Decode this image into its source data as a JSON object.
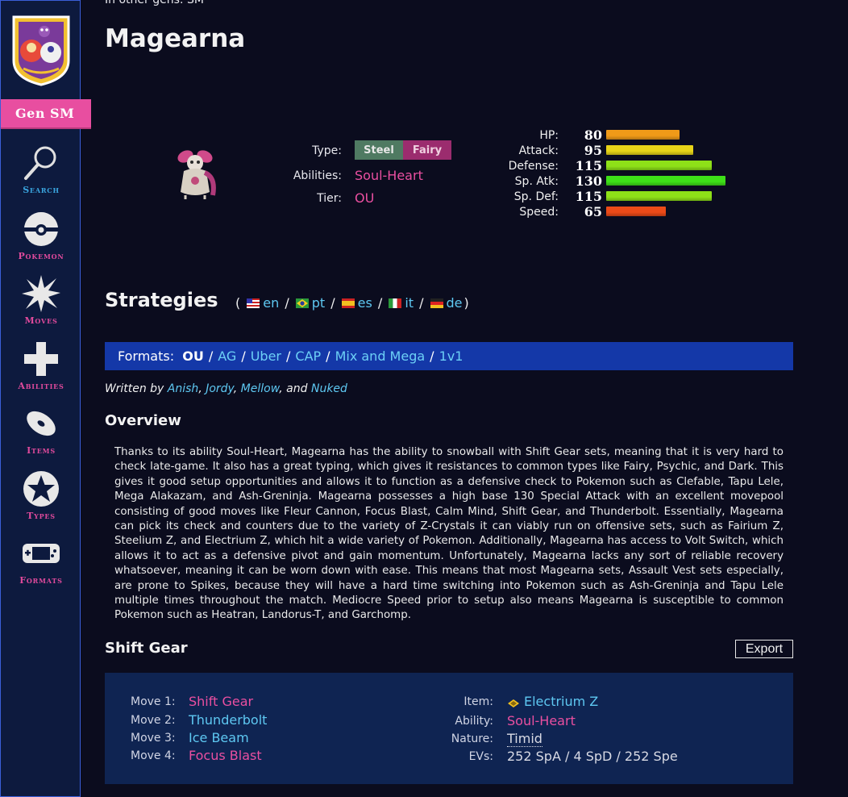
{
  "sidebar": {
    "gen_label": "Gen SM",
    "nav": [
      {
        "label": "Search",
        "icon": "search-icon"
      },
      {
        "label": "Pokemon",
        "icon": "pokeball-icon"
      },
      {
        "label": "Moves",
        "icon": "burst-icon"
      },
      {
        "label": "Abilities",
        "icon": "plus-icon"
      },
      {
        "label": "Items",
        "icon": "disc-icon"
      },
      {
        "label": "Types",
        "icon": "star-icon"
      },
      {
        "label": "Formats",
        "icon": "gameboy-icon"
      }
    ]
  },
  "header": {
    "other_gens": "In other gens: SM",
    "title": "Magearna"
  },
  "info": {
    "type_label": "Type:",
    "types": [
      "Steel",
      "Fairy"
    ],
    "abilities_label": "Abilities:",
    "ability": "Soul-Heart",
    "tier_label": "Tier:",
    "tier": "OU"
  },
  "stats": [
    {
      "name": "HP:",
      "value": 80,
      "color": "#f09a18"
    },
    {
      "name": "Attack:",
      "value": 95,
      "color": "#e8d418"
    },
    {
      "name": "Defense:",
      "value": 115,
      "color": "#8ee018"
    },
    {
      "name": "Sp. Atk:",
      "value": 130,
      "color": "#3ee018"
    },
    {
      "name": "Sp. Def:",
      "value": 115,
      "color": "#8ee018"
    },
    {
      "name": "Speed:",
      "value": 65,
      "color": "#ec4a18"
    }
  ],
  "strategies": {
    "heading": "Strategies",
    "open_paren": "(",
    "close_paren": ")",
    "languages": [
      "en",
      "pt",
      "es",
      "it",
      "de"
    ]
  },
  "formats": {
    "label": "Formats:",
    "current": "OU",
    "links": [
      "AG",
      "Uber",
      "CAP",
      "Mix and Mega",
      "1v1"
    ]
  },
  "written": {
    "prefix": "Written by",
    "authors": [
      "Anish",
      "Jordy",
      "Mellow",
      "Nuked"
    ],
    "and": "and"
  },
  "overview": {
    "heading": "Overview",
    "text": "Thanks to its ability Soul-Heart, Magearna has the ability to snowball with Shift Gear sets, meaning that it is very hard to check late-game. It also has a great typing, which gives it resistances to common types like Fairy, Psychic, and Dark. This gives it good setup opportunities and allows it to function as a defensive check to Pokemon such as Clefable, Tapu Lele, Mega Alakazam, and Ash-Greninja. Magearna possesses a high base 130 Special Attack with an excellent movepool consisting of good moves like Fleur Cannon, Focus Blast, Calm Mind, Shift Gear, and Thunderbolt. Essentially, Magearna can pick its check and counters due to the variety of Z-Crystals it can viably run on offensive sets, such as Fairium Z, Steelium Z, and Electrium Z, which hit a wide variety of Pokemon. Additionally, Magearna has access to Volt Switch, which allows it to act as a defensive pivot and gain momentum. Unfortunately, Magearna lacks any sort of reliable recovery whatsoever, meaning it can be worn down with ease. This means that most Magearna sets, Assault Vest sets especially, are prone to Spikes, because they will have a hard time switching into Pokemon such as Ash-Greninja and Tapu Lele multiple times throughout the match. Mediocre Speed prior to setup also means Magearna is susceptible to common Pokemon such as Heatran, Landorus-T, and Garchomp."
  },
  "set": {
    "heading": "Shift Gear",
    "export_label": "Export",
    "moves": [
      {
        "label": "Move 1:",
        "name": "Shift Gear"
      },
      {
        "label": "Move 2:",
        "name": "Thunderbolt"
      },
      {
        "label": "Move 3:",
        "name": "Ice Beam"
      },
      {
        "label": "Move 4:",
        "name": "Focus Blast"
      }
    ],
    "item_label": "Item:",
    "item": "Electrium Z",
    "ability_label": "Ability:",
    "ability": "Soul-Heart",
    "nature_label": "Nature:",
    "nature": "Timid",
    "evs_label": "EVs:",
    "evs": "252 SpA / 4 SpD / 252 Spe"
  }
}
